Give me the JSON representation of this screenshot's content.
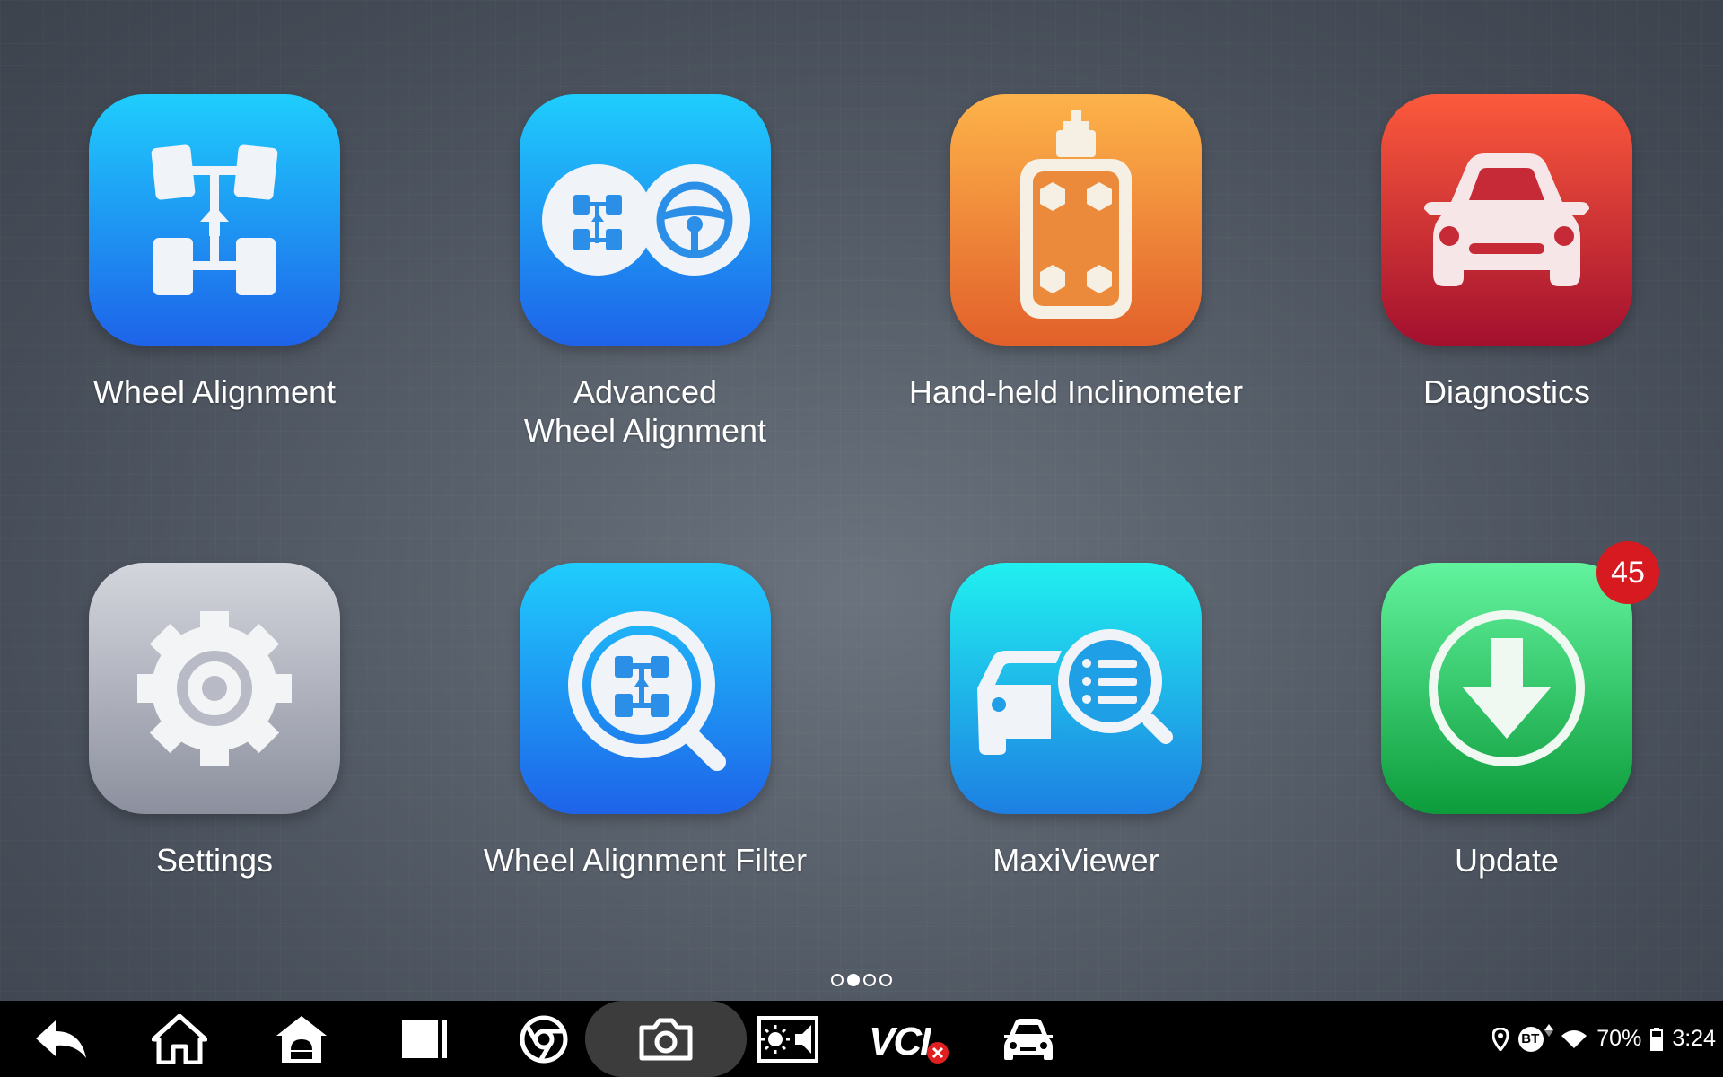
{
  "apps": [
    {
      "label": "Wheel Alignment",
      "icon": "wheel-alignment-icon"
    },
    {
      "label": "Advanced\nWheel Alignment",
      "icon": "advanced-wheel-alignment-icon"
    },
    {
      "label": "Hand-held Inclinometer",
      "icon": "inclinometer-icon"
    },
    {
      "label": "Diagnostics",
      "icon": "car-icon"
    },
    {
      "label": "Settings",
      "icon": "gear-icon"
    },
    {
      "label": "Wheel Alignment Filter",
      "icon": "alignment-filter-icon"
    },
    {
      "label": "MaxiViewer",
      "icon": "maxiviewer-icon"
    },
    {
      "label": "Update",
      "icon": "download-icon",
      "badge": "45"
    }
  ],
  "pager": {
    "pages": 4,
    "active_index": 1
  },
  "taskbar": {
    "buttons": [
      "back-icon",
      "home-icon",
      "android-home-icon",
      "recents-icon",
      "chrome-icon",
      "camera-icon",
      "brightness-volume-icon",
      "vci-icon",
      "car-icon"
    ],
    "vci_label": "VCI"
  },
  "status": {
    "battery": "70%",
    "time": "3:24",
    "bt_label": "BT"
  },
  "colors": {
    "blue_top": "#1fcdfd",
    "blue_bottom": "#1e63e9",
    "orange_top": "#fdb34a",
    "orange_bottom": "#e2602a",
    "red_top": "#fc5a3c",
    "red_bottom": "#a3102e",
    "gray_top": "#d4d6dd",
    "gray_bottom": "#8c909e",
    "cyan_top": "#20f0ef",
    "cyan_bottom": "#1d7fe3",
    "green_top": "#62f39e",
    "green_bottom": "#0d9c3b",
    "badge": "#d71920"
  }
}
